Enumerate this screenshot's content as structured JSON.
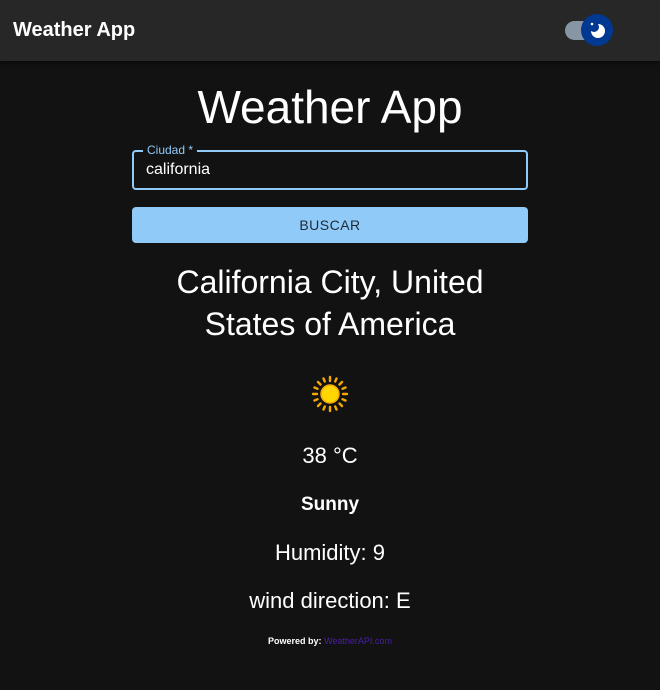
{
  "appbar": {
    "title": "Weather App",
    "theme_toggle": "dark-mode-toggle"
  },
  "main": {
    "heading": "Weather App",
    "search": {
      "label": "Ciudad *",
      "value": "california"
    },
    "button_label": "BUSCAR",
    "location": "California City, United States of America",
    "icon": "sun-icon",
    "temperature": "38 °C",
    "condition": "Sunny",
    "humidity": "Humidity: 9",
    "wind": "wind direction: E",
    "powered_by": "Powered by:",
    "powered_link": "WeatherAPI.com"
  },
  "colors": {
    "accent": "#90caf9",
    "toggle_thumb": "#003892",
    "link": "#4a1fa8"
  }
}
